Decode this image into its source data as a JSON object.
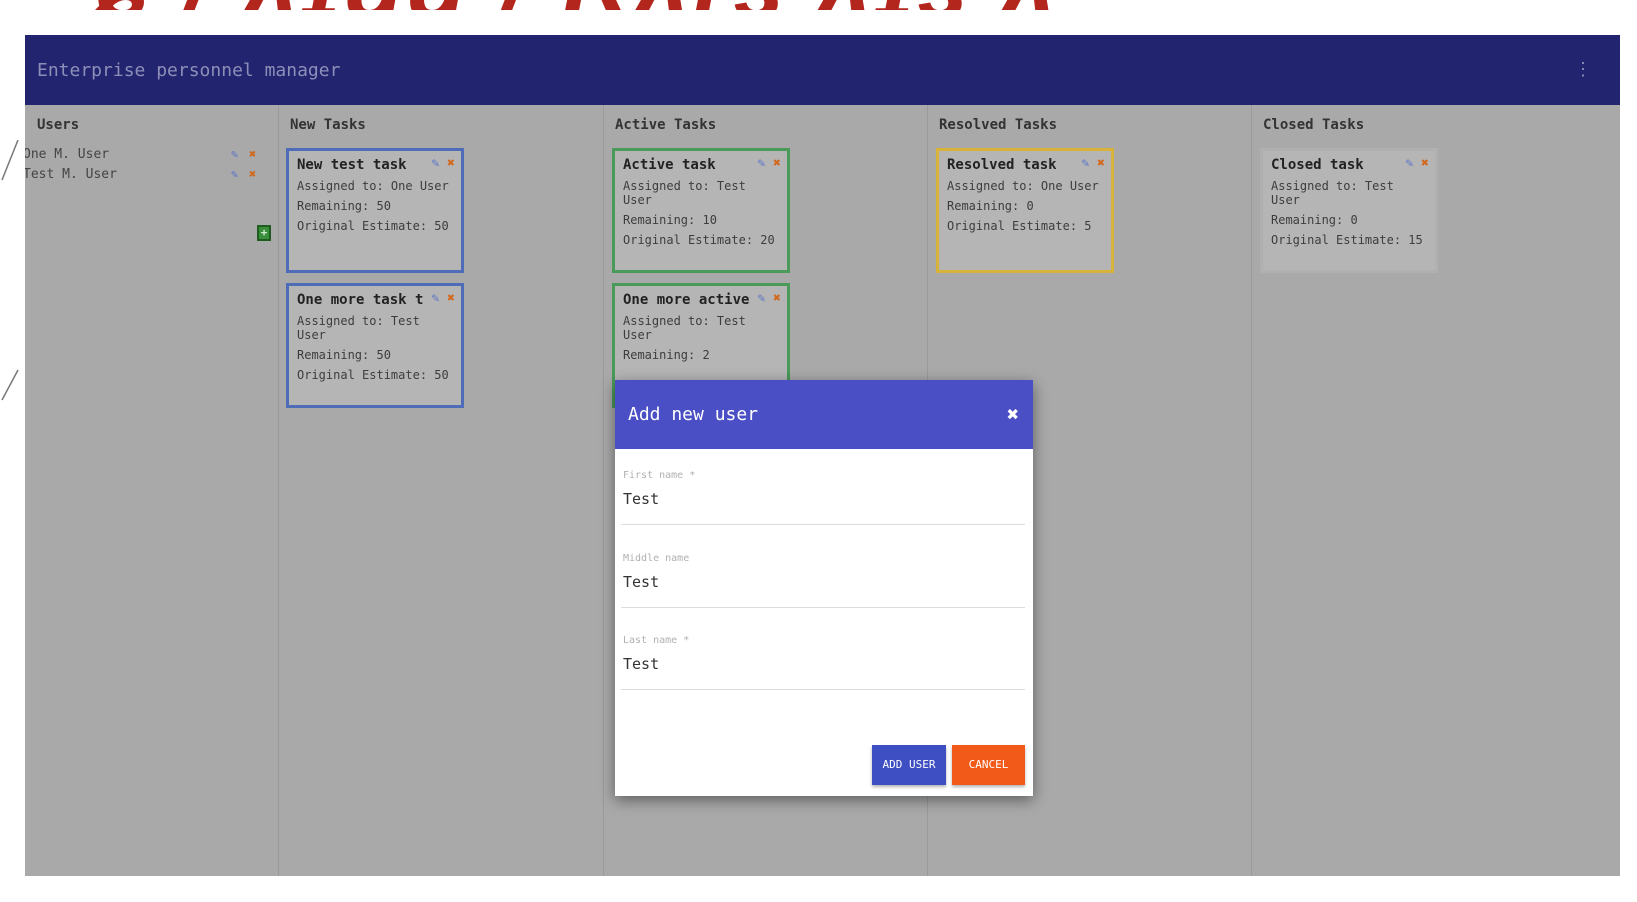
{
  "slide": {
    "title": "ɕ / ᴧɪɗɑ / Ɽᴧɾɜ ᴧɪɜ ᴧ"
  },
  "app": {
    "title": "Enterprise personnel manager",
    "menu_icon": "⋮"
  },
  "columns": {
    "users": "Users",
    "new": "New Tasks",
    "active": "Active Tasks",
    "resolved": "Resolved Tasks",
    "closed": "Closed Tasks"
  },
  "users": [
    {
      "name": "One M. User"
    },
    {
      "name": "Test M. User"
    }
  ],
  "icons": {
    "edit": "edit-icon",
    "delete": "delete-icon",
    "add": "add-icon"
  },
  "cards": {
    "new_1": {
      "title": "New test task",
      "assigned": "Assigned to: One User",
      "remaining": "Remaining: 50",
      "estimate": "Original Estimate: 50"
    },
    "new_2": {
      "title": "One more task t...",
      "assigned": "Assigned to: Test User",
      "remaining": "Remaining: 50",
      "estimate": "Original Estimate: 50"
    },
    "active_1": {
      "title": "Active task",
      "assigned": "Assigned to: Test User",
      "remaining": "Remaining: 10",
      "estimate": "Original Estimate: 20"
    },
    "active_2": {
      "title": "One more active...",
      "assigned": "Assigned to: Test User",
      "remaining": "Remaining: 2"
    },
    "resolved_1": {
      "title": "Resolved task",
      "assigned": "Assigned to: One User",
      "remaining": "Remaining: 0",
      "estimate": "Original Estimate: 5"
    },
    "closed_1": {
      "title": "Closed task",
      "assigned": "Assigned to: Test User",
      "remaining": "Remaining: 0",
      "estimate": "Original Estimate: 15"
    }
  },
  "dialog": {
    "title": "Add new user",
    "close_icon": "✖",
    "first_name_label": "First name *",
    "first_name_value": "Test",
    "middle_name_label": "Middle name",
    "middle_name_value": "Test",
    "last_name_label": "Last name *",
    "last_name_value": "Test",
    "add_button": "ADD USER",
    "cancel_button": "CANCEL"
  },
  "colors": {
    "appbar": "#222470",
    "dialog_header": "#4a4fc6",
    "add_button": "#3d4fc2",
    "cancel_button": "#f25a1a",
    "new_border": "#4f6cb8",
    "active_border": "#4a9a5a",
    "resolved_border": "#d7b33a"
  }
}
